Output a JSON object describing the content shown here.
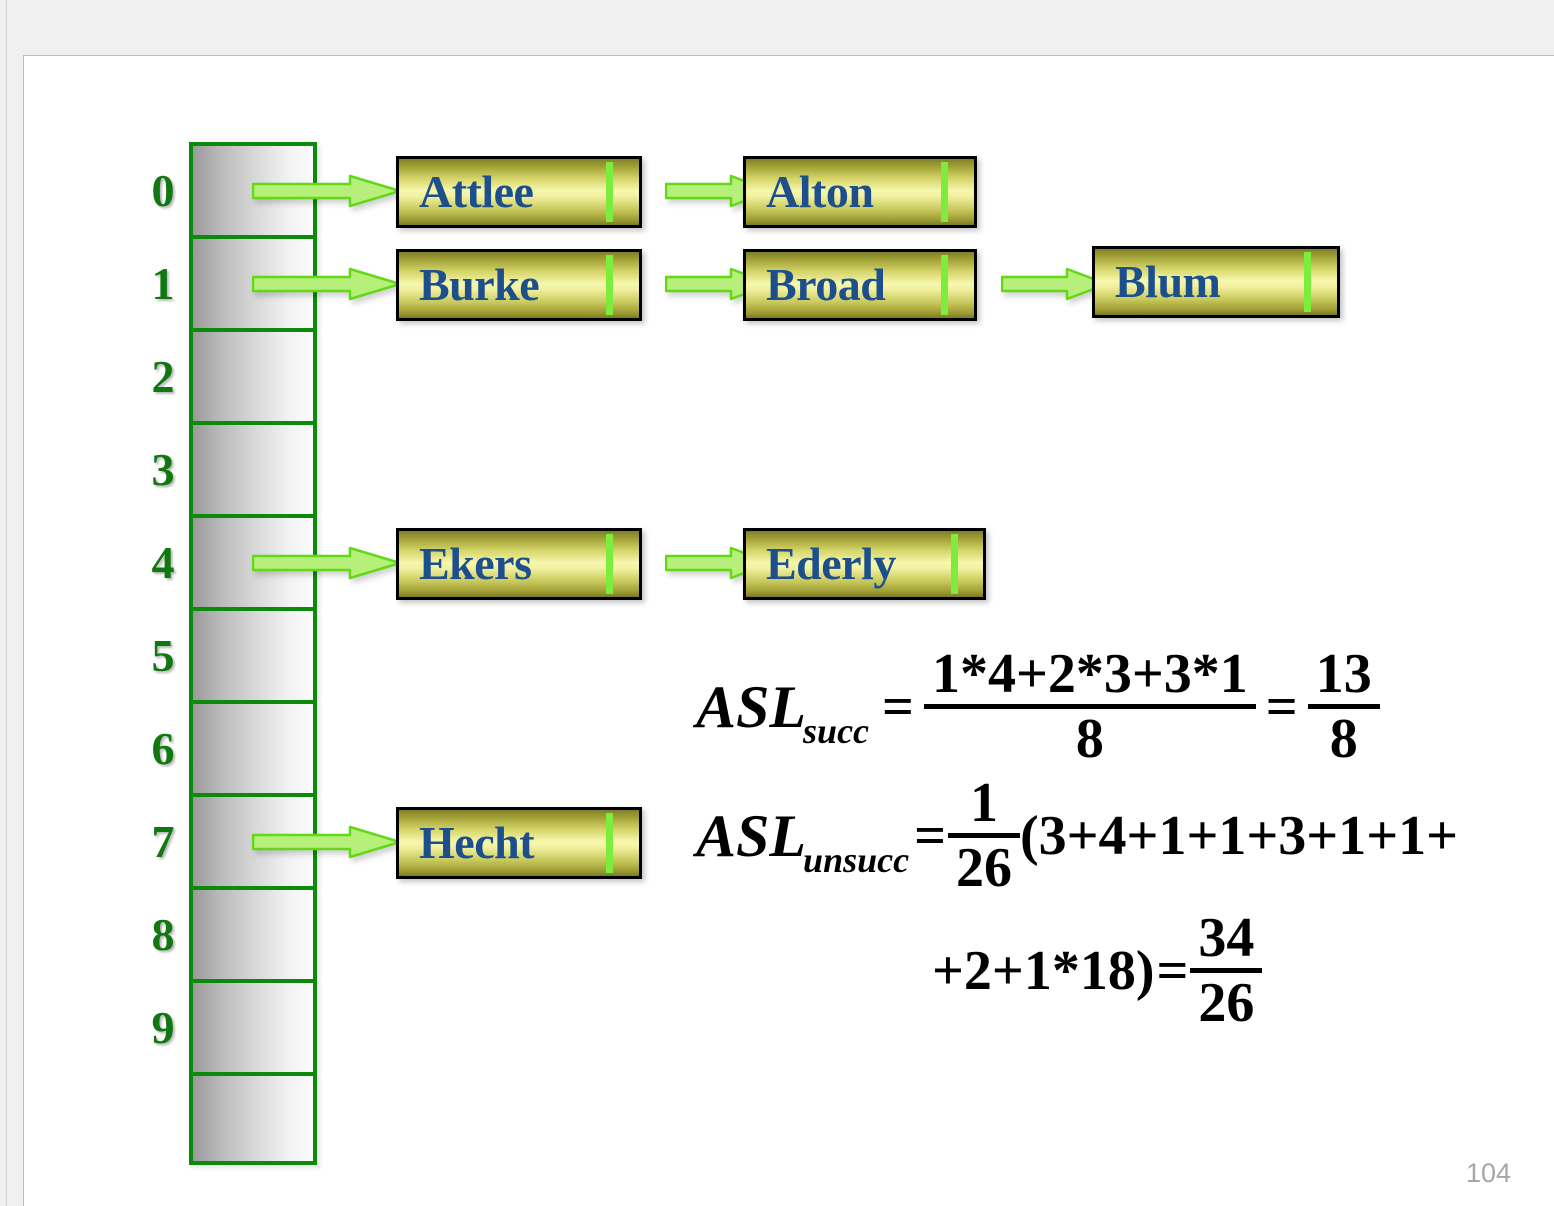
{
  "slide": {
    "page_number": "104",
    "colors": {
      "table_border": "#0b8a0b",
      "index_text": "#117711",
      "node_text": "#1d4f8c",
      "node_pointer": "#7ced3c",
      "arrow_fill": "#b6f07a",
      "arrow_stroke": "#62d916",
      "page_number": "#a6a6a6"
    },
    "hash_table": {
      "buckets": [
        {
          "index": "0",
          "has_chain": true
        },
        {
          "index": "1",
          "has_chain": true
        },
        {
          "index": "2",
          "has_chain": false
        },
        {
          "index": "3",
          "has_chain": false
        },
        {
          "index": "4",
          "has_chain": true
        },
        {
          "index": "5",
          "has_chain": false
        },
        {
          "index": "6",
          "has_chain": false
        },
        {
          "index": "7",
          "has_chain": true
        },
        {
          "index": "8",
          "has_chain": false
        },
        {
          "index": "9",
          "has_chain": false
        },
        {
          "index": "",
          "has_chain": false
        }
      ]
    },
    "chains": [
      {
        "bucket": "0",
        "nodes": [
          "Attlee",
          "Alton"
        ]
      },
      {
        "bucket": "1",
        "nodes": [
          "Burke",
          "Broad",
          "Blum"
        ]
      },
      {
        "bucket": "4",
        "nodes": [
          "Ekers",
          "Ederly"
        ]
      },
      {
        "bucket": "7",
        "nodes": [
          "Hecht"
        ]
      }
    ],
    "nodes": {
      "attlee": "Attlee",
      "alton": "Alton",
      "burke": "Burke",
      "broad": "Broad",
      "blum": "Blum",
      "ekers": "Ekers",
      "ederly": "Ederly",
      "hecht": "Hecht"
    },
    "formulas": {
      "succ": {
        "name": "ASL",
        "subscript": "succ",
        "eq1": "=",
        "numerator": "1*4+2*3+3*1",
        "denominator": "8",
        "eq2": "=",
        "result_numerator": "13",
        "result_denominator": "8"
      },
      "unsucc": {
        "name": "ASL",
        "subscript": "unsucc",
        "eq1": "=",
        "coef_numerator": "1",
        "coef_denominator": "26",
        "expr_part1": "(3+4+1+1+3+1+1+",
        "expr_part2": "+2+1*18)",
        "eq2": "=",
        "result_numerator": "34",
        "result_denominator": "26"
      }
    }
  }
}
